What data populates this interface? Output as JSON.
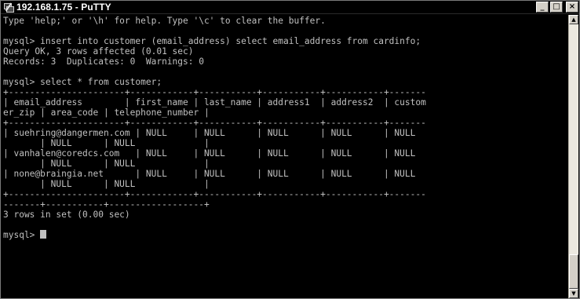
{
  "window": {
    "title": "192.168.1.75 - PuTTY",
    "app_icon": "putty-icon",
    "controls": {
      "minimize_icon": "minimize-icon",
      "minimize_glyph": "_",
      "maximize_icon": "maximize-icon",
      "maximize_glyph": "□",
      "close_icon": "close-icon",
      "close_glyph": "×"
    }
  },
  "terminal": {
    "lines": [
      "Type 'help;' or '\\h' for help. Type '\\c' to clear the buffer.",
      "",
      "mysql> insert into customer (email_address) select email_address from cardinfo;",
      "Query OK, 3 rows affected (0.01 sec)",
      "Records: 3  Duplicates: 0  Warnings: 0",
      "",
      "mysql> select * from customer;",
      "+----------------------+------------+-----------+-----------+-----------+-------",
      "| email_address        | first_name | last_name | address1  | address2  | custom",
      "er_zip | area_code | telephone_number |",
      "+----------------------+------------+-----------+-----------+-----------+-------",
      "| suehring@dangermen.com | NULL     | NULL      | NULL      | NULL      | NULL",
      "       | NULL      | NULL             |",
      "| vanhalen@coredcs.com   | NULL     | NULL      | NULL      | NULL      | NULL",
      "       | NULL      | NULL             |",
      "| none@braingia.net      | NULL     | NULL      | NULL      | NULL      | NULL",
      "       | NULL      | NULL             |",
      "+----------------------+------------+-----------+-----------+-----------+-------",
      "-------+-----------+------------------+",
      "3 rows in set (0.00 sec)",
      "",
      "mysql> "
    ],
    "colors": {
      "background": "#000000",
      "foreground": "#c0c0c0"
    }
  },
  "scrollbar": {
    "up_icon": "scroll-up-arrow-icon",
    "up_glyph": "▲",
    "down_icon": "scroll-down-arrow-icon",
    "down_glyph": "▼"
  }
}
